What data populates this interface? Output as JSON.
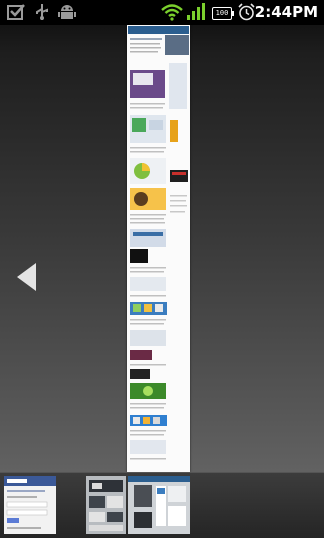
{
  "status_bar": {
    "icons": [
      "checkbox-notification-icon",
      "usb-icon",
      "android-debug-icon",
      "wifi-icon",
      "signal-icon",
      "battery-icon",
      "alarm-icon"
    ],
    "battery_level": "100",
    "time": "2:44PM"
  },
  "browser": {
    "view": "page-overview",
    "back_icon": "back-arrow-icon",
    "thumbnails": [
      "facebook-page-thumbnail",
      "dark-page-thumbnail",
      "current-page-thumbnail"
    ]
  },
  "colors": {
    "status_bar": "#000000",
    "background_top": "#0a0a0a",
    "background_bottom": "#6e6e6e",
    "accent_green": "#7bd02d",
    "facebook_blue": "#3b5998"
  }
}
